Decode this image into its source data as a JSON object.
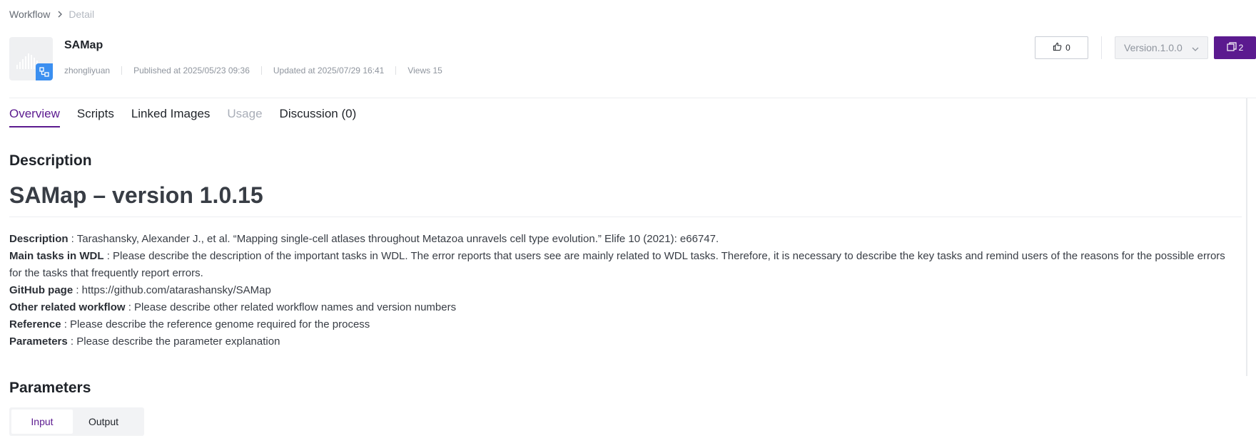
{
  "breadcrumb": {
    "parent": "Workflow",
    "current": "Detail"
  },
  "workflow": {
    "title": "SAMap",
    "author": "zhongliyuan",
    "published": "Published at 2025/05/23 09:36",
    "updated": "Updated at 2025/07/29 16:41",
    "views": "Views 15"
  },
  "actions": {
    "like_count": "0",
    "version": "Version.1.0.0",
    "copy_count": "2"
  },
  "tabs": [
    {
      "label": "Overview",
      "state": "active"
    },
    {
      "label": "Scripts",
      "state": "normal"
    },
    {
      "label": "Linked Images",
      "state": "normal"
    },
    {
      "label": "Usage",
      "state": "disabled"
    },
    {
      "label": "Discussion (0)",
      "state": "normal"
    }
  ],
  "description": {
    "heading": "Description",
    "doc_title": "SAMap – version 1.0.15",
    "rows": [
      {
        "key": "Description",
        "value": " : Tarashansky, Alexander J., et al. “Mapping single-cell atlases throughout Metazoa unravels cell type evolution.” Elife 10 (2021): e66747."
      },
      {
        "key": "Main tasks in WDL",
        "value": " : Please describe the description of the important tasks in WDL. The error reports that users see are mainly related to WDL tasks. Therefore, it is necessary to describe the key tasks and remind users of the reasons for the possible errors for the tasks that frequently report errors."
      },
      {
        "key": "GitHub page",
        "value": " : https://github.com/atarashansky/SAMap"
      },
      {
        "key": "Other related workflow",
        "value": " : Please describe other related workflow names and version numbers"
      },
      {
        "key": "Reference",
        "value": " : Please describe the reference genome required for the process"
      },
      {
        "key": "Parameters",
        "value": " : Please describe the parameter explanation"
      }
    ]
  },
  "parameters": {
    "heading": "Parameters",
    "tabs": [
      {
        "label": "Input",
        "state": "active"
      },
      {
        "label": "Output",
        "state": "normal"
      }
    ]
  },
  "colors": {
    "accent": "#5b1a8f",
    "badge": "#3b8ff0"
  }
}
